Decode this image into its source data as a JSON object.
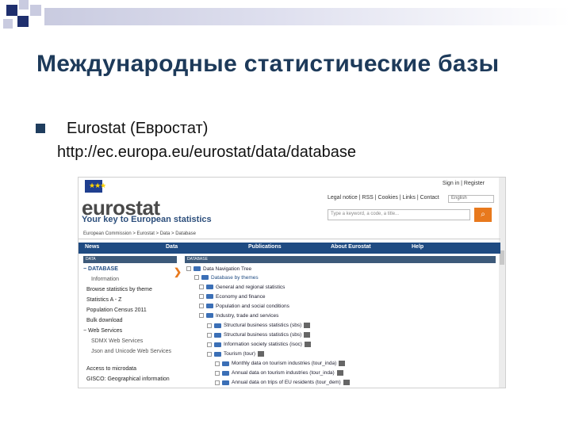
{
  "slide": {
    "title": "Международные статистические базы",
    "bullet_line1": "Eurostat (Евростат)",
    "bullet_line2": "http://ec.europa.eu/eurostat/data/database"
  },
  "screenshot": {
    "toplinks": "Sign in | Register",
    "logo": "eurostat",
    "tagline": "Your key to European statistics",
    "midlinks": "Legal notice | RSS | Cookies | Links | Contact",
    "language": "English",
    "search_placeholder": "Type a keyword, a code, a title...",
    "breadcrumb": "European Commission > Eurostat > Data > Database",
    "nav": [
      "News",
      "Data",
      "Publications",
      "About Eurostat",
      "Help"
    ],
    "left_header": "DATA",
    "right_header": "DATABASE",
    "left_items": [
      "− DATABASE",
      "Information",
      "Browse statistics by theme",
      "Statistics A - Z",
      "Population Census 2011",
      "Bulk download",
      "− Web Services",
      "SDMX Web Services",
      "Json and Unicode Web Services",
      "Access to microdata",
      "GISCO: Geographical information"
    ],
    "tree_items": [
      "Data Navigation Tree",
      "Database by themes",
      "General and regional statistics",
      "Economy and finance",
      "Population and social conditions",
      "Industry, trade and services",
      "Structural business statistics (sbs)",
      "Structural business statistics (sbs)",
      "Information society statistics (isoc)",
      "Tourism (tour)",
      "Monthly data on tourism industries (tour_inda)",
      "Annual data on tourism industries (tour_inda)",
      "Annual data on trips of EU residents (tour_dem)"
    ]
  }
}
